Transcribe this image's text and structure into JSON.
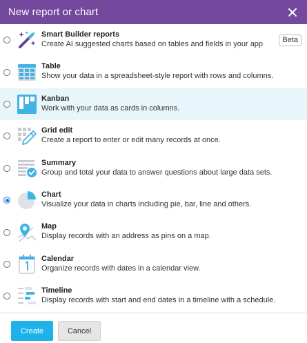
{
  "dialog": {
    "title": "New report or chart",
    "close_icon": "close-icon"
  },
  "options": [
    {
      "id": "smart-builder",
      "title": "Smart Builder reports",
      "desc": "Create AI suggested charts based on tables and fields in your app",
      "badge": "Beta",
      "icon": "magic-wand-icon",
      "selected": false,
      "highlighted": false
    },
    {
      "id": "table",
      "title": "Table",
      "desc": "Show your data in a spreadsheet-style report with rows and columns.",
      "icon": "table-icon",
      "selected": false,
      "highlighted": false
    },
    {
      "id": "kanban",
      "title": "Kanban",
      "desc": "Work with your data as cards in columns.",
      "icon": "kanban-icon",
      "selected": false,
      "highlighted": true
    },
    {
      "id": "grid-edit",
      "title": "Grid edit",
      "desc": "Create a report to enter or edit many records at once.",
      "icon": "grid-edit-icon",
      "selected": false,
      "highlighted": false
    },
    {
      "id": "summary",
      "title": "Summary",
      "desc": "Group and total your data to answer questions about large data sets.",
      "icon": "summary-icon",
      "selected": false,
      "highlighted": false
    },
    {
      "id": "chart",
      "title": "Chart",
      "desc": "Visualize your data in charts including pie, bar, line and others.",
      "icon": "pie-chart-icon",
      "selected": true,
      "highlighted": false
    },
    {
      "id": "map",
      "title": "Map",
      "desc": "Display records with an address as pins on a map.",
      "icon": "map-pin-icon",
      "selected": false,
      "highlighted": false
    },
    {
      "id": "calendar",
      "title": "Calendar",
      "desc": "Organize records with dates in a calendar view.",
      "icon": "calendar-icon",
      "selected": false,
      "highlighted": false
    },
    {
      "id": "timeline",
      "title": "Timeline",
      "desc": "Display records with start and end dates in a timeline with a schedule.",
      "icon": "timeline-icon",
      "selected": false,
      "highlighted": false
    }
  ],
  "footer": {
    "create_label": "Create",
    "cancel_label": "Cancel"
  },
  "colors": {
    "header": "#74489d",
    "accent": "#1db2ea",
    "highlight": "#e8f6fb",
    "icon_blue": "#3fb3e6",
    "icon_gray": "#c7cbd1",
    "wand_purple": "#6a3fa0"
  }
}
